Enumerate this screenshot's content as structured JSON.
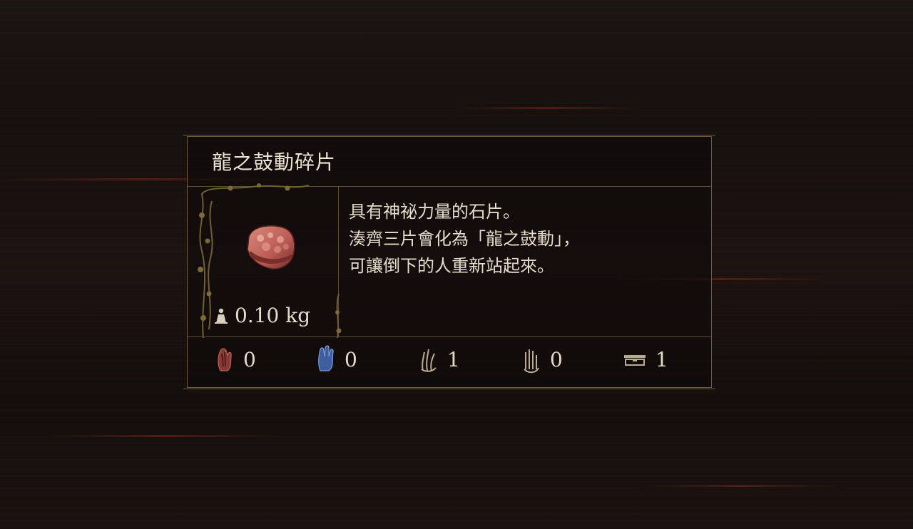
{
  "item": {
    "name": "龍之鼓動碎片",
    "icon": "heart-fragment-icon",
    "weight": "0.10 kg",
    "weight_icon": "weight-icon",
    "description": [
      "具有神祕力量的石片。",
      "湊齊三片會化為「龍之鼓動」，",
      "可讓倒下的人重新站起來。"
    ]
  },
  "stats": [
    {
      "icon": "red-hand-icon",
      "value": "0",
      "color": "#8a3a34"
    },
    {
      "icon": "blue-hand-icon",
      "value": "0",
      "color": "#4a6fb5"
    },
    {
      "icon": "claw-hand-icon",
      "value": "1",
      "color": "#b9ab90"
    },
    {
      "icon": "open-hand-icon",
      "value": "0",
      "color": "#b9ab90"
    },
    {
      "icon": "chest-icon",
      "value": "1",
      "color": "#b9ab90"
    }
  ],
  "colors": {
    "border": "#6b5a3e",
    "text": "#e4dccb",
    "item_tint": "#b85a52"
  }
}
